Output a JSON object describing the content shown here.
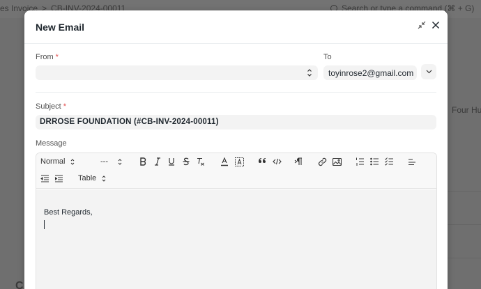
{
  "background": {
    "breadcrumb": [
      "es Invoice",
      "CB-INV-2024-00011"
    ],
    "breadcrumb_sep": ">",
    "search_placeholder": "Search or type a command (⌘ + G)",
    "side_text": "Four Hu",
    "bottom_letter": "C"
  },
  "dialog": {
    "title": "New Email",
    "icons": {
      "minimize": "minimize-icon",
      "close": "close-icon"
    }
  },
  "fields": {
    "from": {
      "label": "From",
      "required_mark": "*",
      "value": ""
    },
    "to": {
      "label": "To",
      "value": "toyinrose2@gmail.com"
    },
    "subject": {
      "label": "Subject",
      "required_mark": "*",
      "value": "DRROSE FOUNDATION (#CB-INV-2024-00011)"
    },
    "message": {
      "label": "Message"
    }
  },
  "toolbar": {
    "header_select": "Normal",
    "size_select": "---",
    "table_select": "Table",
    "buttons": [
      "bold",
      "italic",
      "underline",
      "strike",
      "clean",
      "color",
      "background",
      "blockquote",
      "code-block",
      "direction",
      "link",
      "image",
      "ordered-list",
      "bullet-list",
      "check-list",
      "align",
      "outdent",
      "indent"
    ]
  },
  "editor": {
    "lines": [
      "Best Regards,"
    ]
  }
}
